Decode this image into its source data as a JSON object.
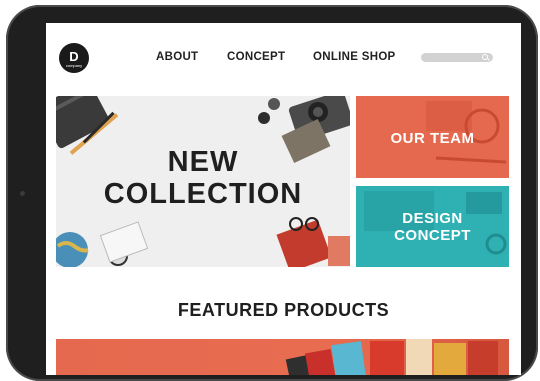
{
  "header": {
    "logo": {
      "letter": "D",
      "subtitle": "company"
    },
    "nav": [
      "ABOUT",
      "CONCEPT",
      "ONLINE SHOP"
    ],
    "search_placeholder": ""
  },
  "hero": {
    "title_line1": "NEW",
    "title_line2": "COLLECTION"
  },
  "tiles": [
    {
      "label": "OUR TEAM",
      "color": "#e5694e"
    },
    {
      "label_line1": "DESIGN",
      "label_line2": "CONCEPT",
      "color": "#2fb0b3"
    }
  ],
  "featured": {
    "heading": "FEATURED PRODUCTS"
  },
  "colors": {
    "device": "#1f1f1f",
    "accent_orange": "#e5694e",
    "accent_teal": "#2fb0b3"
  }
}
